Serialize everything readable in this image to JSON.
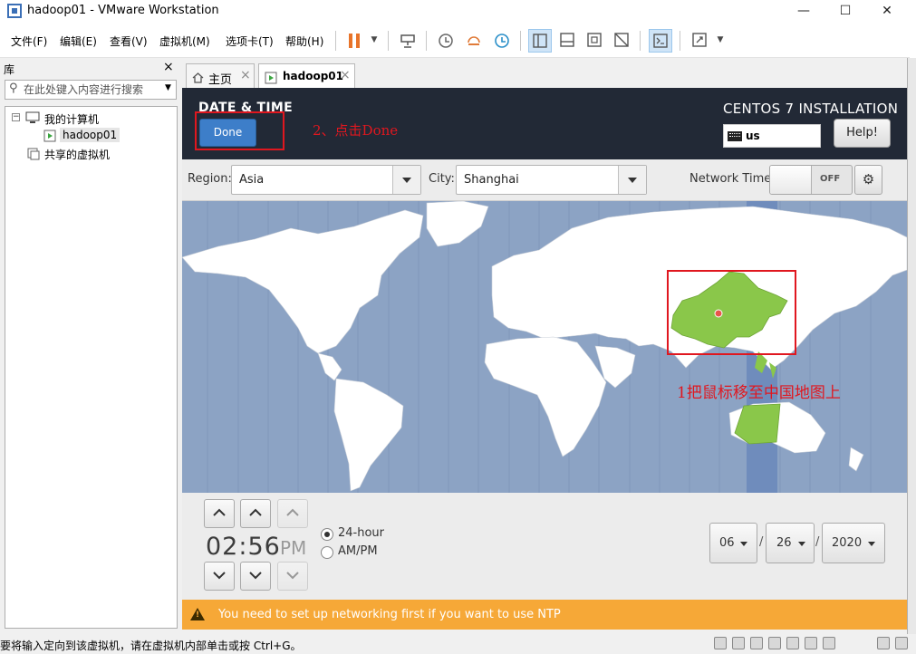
{
  "window": {
    "title": "hadoop01 - VMware Workstation",
    "controls": {
      "minimize": "—",
      "maximize": "☐",
      "close": "✕"
    }
  },
  "menubar": {
    "items": [
      {
        "label": "文件(F)"
      },
      {
        "label": "编辑(E)"
      },
      {
        "label": "查看(V)"
      },
      {
        "label": "虚拟机(M)"
      },
      {
        "label": "选项卡(T)"
      },
      {
        "label": "帮助(H)"
      }
    ]
  },
  "library": {
    "title": "库",
    "close": "×",
    "search_placeholder": "在此处键入内容进行搜索",
    "tree": {
      "root": "我的计算机",
      "vm": "hadoop01",
      "shared": "共享的虚拟机"
    }
  },
  "tabs": [
    {
      "label": "主页",
      "close": "×"
    },
    {
      "label": "hadoop01",
      "close": "×"
    }
  ],
  "installer": {
    "header_title": "DATE & TIME",
    "done_label": "Done",
    "product_title": "CENTOS 7 INSTALLATION",
    "keyboard_layout": "us",
    "help_label": "Help!",
    "region_label": "Region:",
    "region_value": "Asia",
    "city_label": "City:",
    "city_value": "Shanghai",
    "network_time_label": "Network Time",
    "network_time_state": "OFF",
    "time": {
      "hours": "02",
      "minutes": "56",
      "display": "02:56",
      "ampm": "PM",
      "format_24h_label": "24-hour",
      "format_ampm_label": "AM/PM",
      "selected_format": "24-hour"
    },
    "date": {
      "month": "06",
      "day": "26",
      "year": "2020",
      "separator": "/"
    },
    "warning": "You need to set up networking first if you want to use NTP"
  },
  "annotations": {
    "step2": "2、点击Done",
    "step1": "1把鼠标移至中国地图上"
  },
  "statusbar": {
    "text": "要将输入定向到该虚拟机，请在虚拟机内部单击或按 Ctrl+G。"
  },
  "colors": {
    "header_bg": "#222936",
    "done_blue": "#3d7ec9",
    "map_ocean": "#8ca3c4",
    "map_highlight": "#8ac74a",
    "warning_bg": "#f6a837",
    "annotation_red": "#e0171f"
  }
}
